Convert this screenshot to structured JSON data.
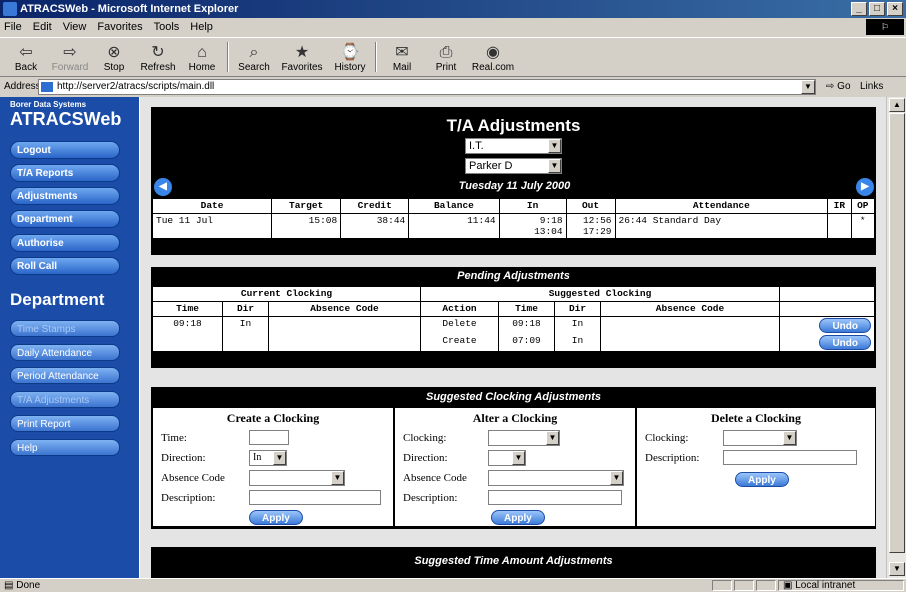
{
  "window": {
    "title": "ATRACSWeb - Microsoft Internet Explorer",
    "controls": [
      "_",
      "□",
      "×"
    ]
  },
  "menu": [
    "File",
    "Edit",
    "View",
    "Favorites",
    "Tools",
    "Help"
  ],
  "toolbar": [
    {
      "label": "Back",
      "icon": "back-arrow-icon",
      "glyph": "⇦"
    },
    {
      "label": "Forward",
      "icon": "forward-arrow-icon",
      "glyph": "⇨"
    },
    {
      "label": "Stop",
      "icon": "stop-icon",
      "glyph": "⊗"
    },
    {
      "label": "Refresh",
      "icon": "refresh-icon",
      "glyph": "↻"
    },
    {
      "label": "Home",
      "icon": "home-icon",
      "glyph": "⌂"
    },
    {
      "label": "Search",
      "icon": "search-icon",
      "glyph": "⌕"
    },
    {
      "label": "Favorites",
      "icon": "favorites-icon",
      "glyph": "★"
    },
    {
      "label": "History",
      "icon": "history-icon",
      "glyph": "⌚"
    },
    {
      "label": "Mail",
      "icon": "mail-icon",
      "glyph": "✉"
    },
    {
      "label": "Print",
      "icon": "print-icon",
      "glyph": "⎙"
    },
    {
      "label": "Real.com",
      "icon": "real-icon",
      "glyph": "◉"
    }
  ],
  "address": {
    "label": "Address",
    "url": "http://server2/atracs/scripts/main.dll",
    "go": "Go",
    "links": "Links"
  },
  "sidebar": {
    "brand_small": "Borer Data Systems",
    "brand": "ATRACSWeb",
    "nav": [
      "Logout",
      "T/A Reports",
      "Adjustments",
      "Department",
      "Authorise",
      "Roll Call"
    ],
    "dept_title": "Department",
    "dept_nav": [
      "Time Stamps",
      "Daily Attendance",
      "Period Attendance",
      "T/A Adjustments",
      "Print Report",
      "Help"
    ]
  },
  "ta": {
    "title": "T/A Adjustments",
    "dept_select": "I.T.",
    "person_select": "Parker D",
    "date": "Tuesday 11 July 2000",
    "headers": [
      "Date",
      "Target",
      "Credit",
      "Balance",
      "In",
      "Out",
      "Attendance",
      "IR",
      "OP"
    ],
    "row": {
      "date": "Tue 11 Jul",
      "target": "15:08",
      "credit": "38:44",
      "balance": "11:44",
      "in1": "9:18",
      "out1": "12:56",
      "in2": "13:04",
      "out2": "17:29",
      "att_time": "26:44",
      "att_type": "Standard Day",
      "ir": "",
      "op": "*"
    }
  },
  "pending": {
    "title": "Pending Adjustments",
    "current": "Current Clocking",
    "suggested": "Suggested Clocking",
    "headers": [
      "Time",
      "Dir",
      "Absence Code",
      "Action",
      "Time",
      "Dir",
      "Absence Code"
    ],
    "rows": [
      {
        "time": "09:18",
        "dir": "In",
        "action": "Delete",
        "stime": "09:18",
        "sdir": "In",
        "undo": "Undo"
      },
      {
        "time": "",
        "dir": "",
        "action": "Create",
        "stime": "07:09",
        "sdir": "In",
        "undo": "Undo"
      }
    ]
  },
  "suggested": {
    "title": "Suggested Clocking Adjustments",
    "create": {
      "title": "Create a Clocking",
      "time": "Time:",
      "direction": "Direction:",
      "dir_value": "In",
      "absence": "Absence Code",
      "description": "Description:",
      "apply": "Apply"
    },
    "alter": {
      "title": "Alter a Clocking",
      "clocking": "Clocking:",
      "direction": "Direction:",
      "absence": "Absence Code",
      "description": "Description:",
      "apply": "Apply"
    },
    "delete": {
      "title": "Delete a Clocking",
      "clocking": "Clocking:",
      "description": "Description:",
      "apply": "Apply"
    }
  },
  "amount": {
    "title": "Suggested Time Amount Adjustments"
  },
  "status": {
    "text": "Done",
    "zone": "Local intranet"
  }
}
